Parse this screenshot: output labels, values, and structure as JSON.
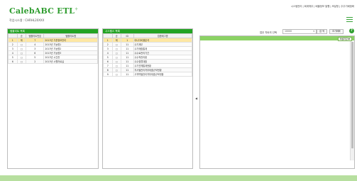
{
  "header": {
    "logo": "CalebABC ETL",
    "logo_mark": "+",
    "session": "작업시스템 : CHRHL20XXX",
    "topnav": "시스템관리 | 회계채무 | 배출정보 발행 | 조달청 | 주주기배정화"
  },
  "left_panel": {
    "title": "템플리트 목록",
    "columns": [
      "",
      "순",
      "템플리트번호",
      "템플리트명"
    ],
    "rows": [
      {
        "num": "1",
        "chk": "체",
        "id": "7",
        "name": "2013년 기준정보관리",
        "selected": true
      },
      {
        "num": "2",
        "chk": "□",
        "id": "4",
        "name": "2013년 기능명1",
        "selected": false
      },
      {
        "num": "3",
        "chk": "□",
        "id": "3",
        "name": "2013년 기능명2",
        "selected": false
      },
      {
        "num": "4",
        "chk": "□",
        "id": "6",
        "name": "2013년 기능명3",
        "selected": false
      },
      {
        "num": "5",
        "chk": "□",
        "id": "5",
        "name": "2013년 시간관",
        "selected": false
      },
      {
        "num": "6",
        "chk": "□",
        "id": "2",
        "name": "2013년 시행자료실",
        "selected": false
      }
    ]
  },
  "mid_panel": {
    "title": "시스템스 목록",
    "columns": [
      "",
      "순",
      "ID",
      "업종태그명"
    ],
    "rows": [
      {
        "num": "1",
        "chk": "체",
        "id": "1",
        "name": "아니다비율분석",
        "selected": true
      },
      {
        "num": "2",
        "chk": "□",
        "id": "11",
        "name": "수기재무",
        "selected": false
      },
      {
        "num": "3",
        "chk": "□",
        "id": "11",
        "name": "수기매출통계",
        "selected": false
      },
      {
        "num": "4",
        "chk": "□",
        "id": "11",
        "name": "수수료관리기간",
        "selected": false
      },
      {
        "num": "5",
        "chk": "□",
        "id": "11",
        "name": "수수적관리량",
        "selected": false
      },
      {
        "num": "6",
        "chk": "□",
        "id": "11",
        "name": "수수할류대출",
        "selected": false
      },
      {
        "num": "7",
        "chk": "□",
        "id": "11",
        "name": "수기연체통계현황",
        "selected": false
      },
      {
        "num": "8",
        "chk": "□",
        "id": "11",
        "name": "지사별관리처부대출규모현황",
        "selected": false
      },
      {
        "num": "9",
        "chk": "□",
        "id": "11",
        "name": "고객역별관리처부대출규모현황",
        "selected": false
      }
    ]
  },
  "arrows": {
    "left": "◀",
    "mid_top": "▶",
    "mid_bot": "▶"
  },
  "right_panel": {
    "label": "업무 차트의 선택",
    "select_value": "10000",
    "select_arrow": "▾",
    "search_button": "검 색",
    "reset_button": "초기화화",
    "export_button": "엑셀저장 ▼",
    "help": "?"
  },
  "colors": {
    "brand": "#23a323",
    "footer": "#b7df9f",
    "selected_row": "#fde7a3"
  }
}
